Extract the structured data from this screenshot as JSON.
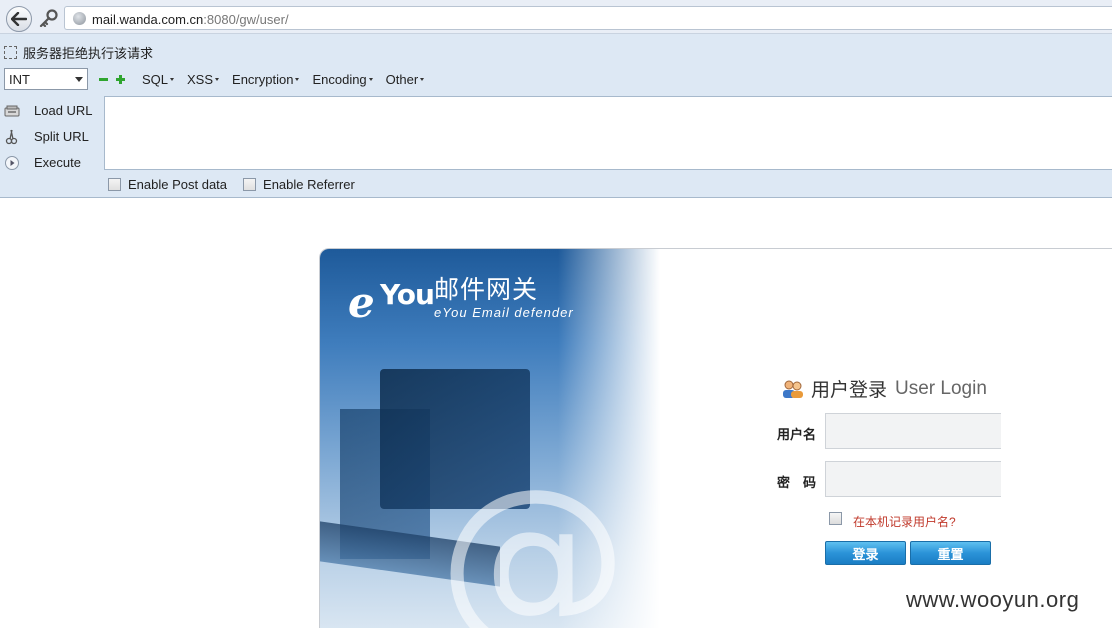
{
  "browser": {
    "url_host": "mail.wanda.com.cn",
    "url_path": ":8080/gw/user/"
  },
  "hackbar": {
    "reject_text": "服务器拒绝执行该请求",
    "type_select": "INT",
    "menus": [
      "SQL",
      "XSS",
      "Encryption",
      "Encoding",
      "Other"
    ],
    "actions": [
      {
        "label": "Load URL",
        "icon": "load-url-icon"
      },
      {
        "label": "Split URL",
        "icon": "scissors-icon"
      },
      {
        "label": "Execute",
        "icon": "play-icon"
      }
    ],
    "textarea_value": "",
    "post_data_label": "Enable Post data",
    "referrer_label": "Enable Referrer"
  },
  "login": {
    "brand_cn": "邮件网关",
    "brand_en": "eYou Email defender",
    "brand_e": "e",
    "brand_you": "You",
    "title_cn": "用户登录",
    "title_en": "User Login",
    "username_label": "用户名",
    "password_label": "密　码",
    "username_value": "",
    "password_value": "",
    "remember_label": "在本机记录用户名?",
    "login_button": "登录",
    "reset_button": "重置"
  },
  "watermark": "www.wooyun.org",
  "colors": {
    "hackbar_bg": "#dde8f4",
    "button_blue": "#2b93d8",
    "remember_red": "#c0392b"
  }
}
